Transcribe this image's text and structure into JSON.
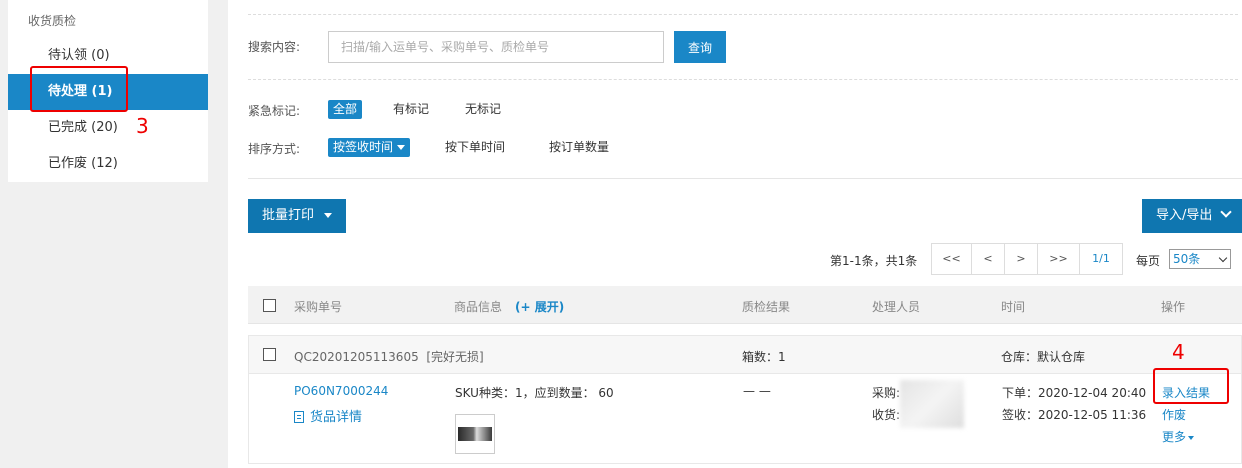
{
  "sidebar": {
    "header": "收货质检",
    "items": [
      {
        "label": "待认领 (0)"
      },
      {
        "label": "待处理 (1)"
      },
      {
        "label": "已完成 (20)"
      },
      {
        "label": "已作废 (12)"
      }
    ]
  },
  "annotations": {
    "step3": "3",
    "step4": "4"
  },
  "search": {
    "label": "搜索内容:",
    "placeholder": "扫描/输入运单号、采购单号、质检单号",
    "button": "查询"
  },
  "filters": {
    "urgent_label": "紧急标记:",
    "urgent_options": [
      "全部",
      "有标记",
      "无标记"
    ],
    "sort_label": "排序方式:",
    "sort_options": [
      "按签收时间",
      "按下单时间",
      "按订单数量"
    ]
  },
  "toolbar": {
    "batch_print": "批量打印",
    "import_export": "导入/导出"
  },
  "pager": {
    "summary": "第1-1条，共1条",
    "first": "<<",
    "prev": "<",
    "next": ">",
    "last": ">>",
    "page": "1/1",
    "per_page_label": "每页",
    "per_page_value": "50条"
  },
  "table": {
    "headers": {
      "po": "采购单号",
      "product": "商品信息",
      "expand": "(+ 展开)",
      "result": "质检结果",
      "handler": "处理人员",
      "time": "时间",
      "action": "操作"
    },
    "rows": [
      {
        "qc_no": "QC20201205113605",
        "qc_tag": "[完好无损]",
        "box_count": "箱数：1",
        "warehouse": "仓库：默认仓库",
        "po_no": "PO60N7000244",
        "detail_link": "货品详情",
        "sku_info": "SKU种类：1，应到数量： 60",
        "qc_result": "— —",
        "buyer_label": "采购:",
        "receiver_label": "收货:",
        "order_time": "下单：2020-12-04 20:40",
        "sign_time": "签收：2020-12-05 11:36",
        "actions": {
          "enter": "录入结果",
          "void": "作废",
          "more": "更多"
        }
      }
    ]
  },
  "colors": {
    "accent": "#1a87c7",
    "button": "#0f76b0",
    "annotation": "#e00000"
  }
}
